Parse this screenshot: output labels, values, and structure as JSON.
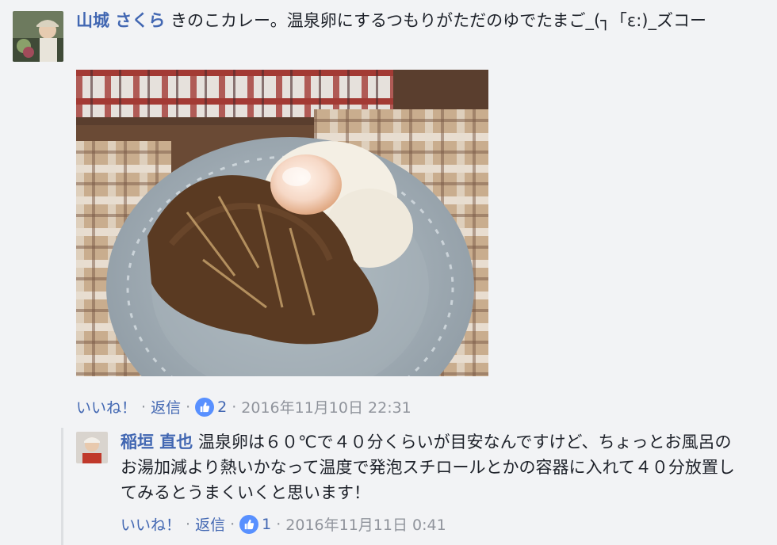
{
  "comments": [
    {
      "author": "山城 さくら",
      "text": "きのこカレー。温泉卵にするつもりがただのゆでたまご_(┐「ε:)_ズコー",
      "actions": {
        "like_label": "いいね！",
        "reply_label": "返信",
        "like_count": "2",
        "timestamp": "2016年11月10日 22:31"
      }
    },
    {
      "author": "稲垣 直也",
      "text": "温泉卵は６０℃で４０分くらいが目安なんですけど、ちょっとお風呂のお湯加減より熱いかなって温度で発泡スチロールとかの容器に入れて４０分放置してみるとうまくいくと思います！",
      "actions": {
        "like_label": "いいね！",
        "reply_label": "返信",
        "like_count": "1",
        "timestamp": "2016年11月11日 0:41"
      }
    }
  ],
  "colors": {
    "link": "#4267b2",
    "meta": "#90949c",
    "background": "#f2f3f5",
    "like_badge": "#5890ff"
  },
  "icons": [
    "thumbs-up-icon"
  ]
}
